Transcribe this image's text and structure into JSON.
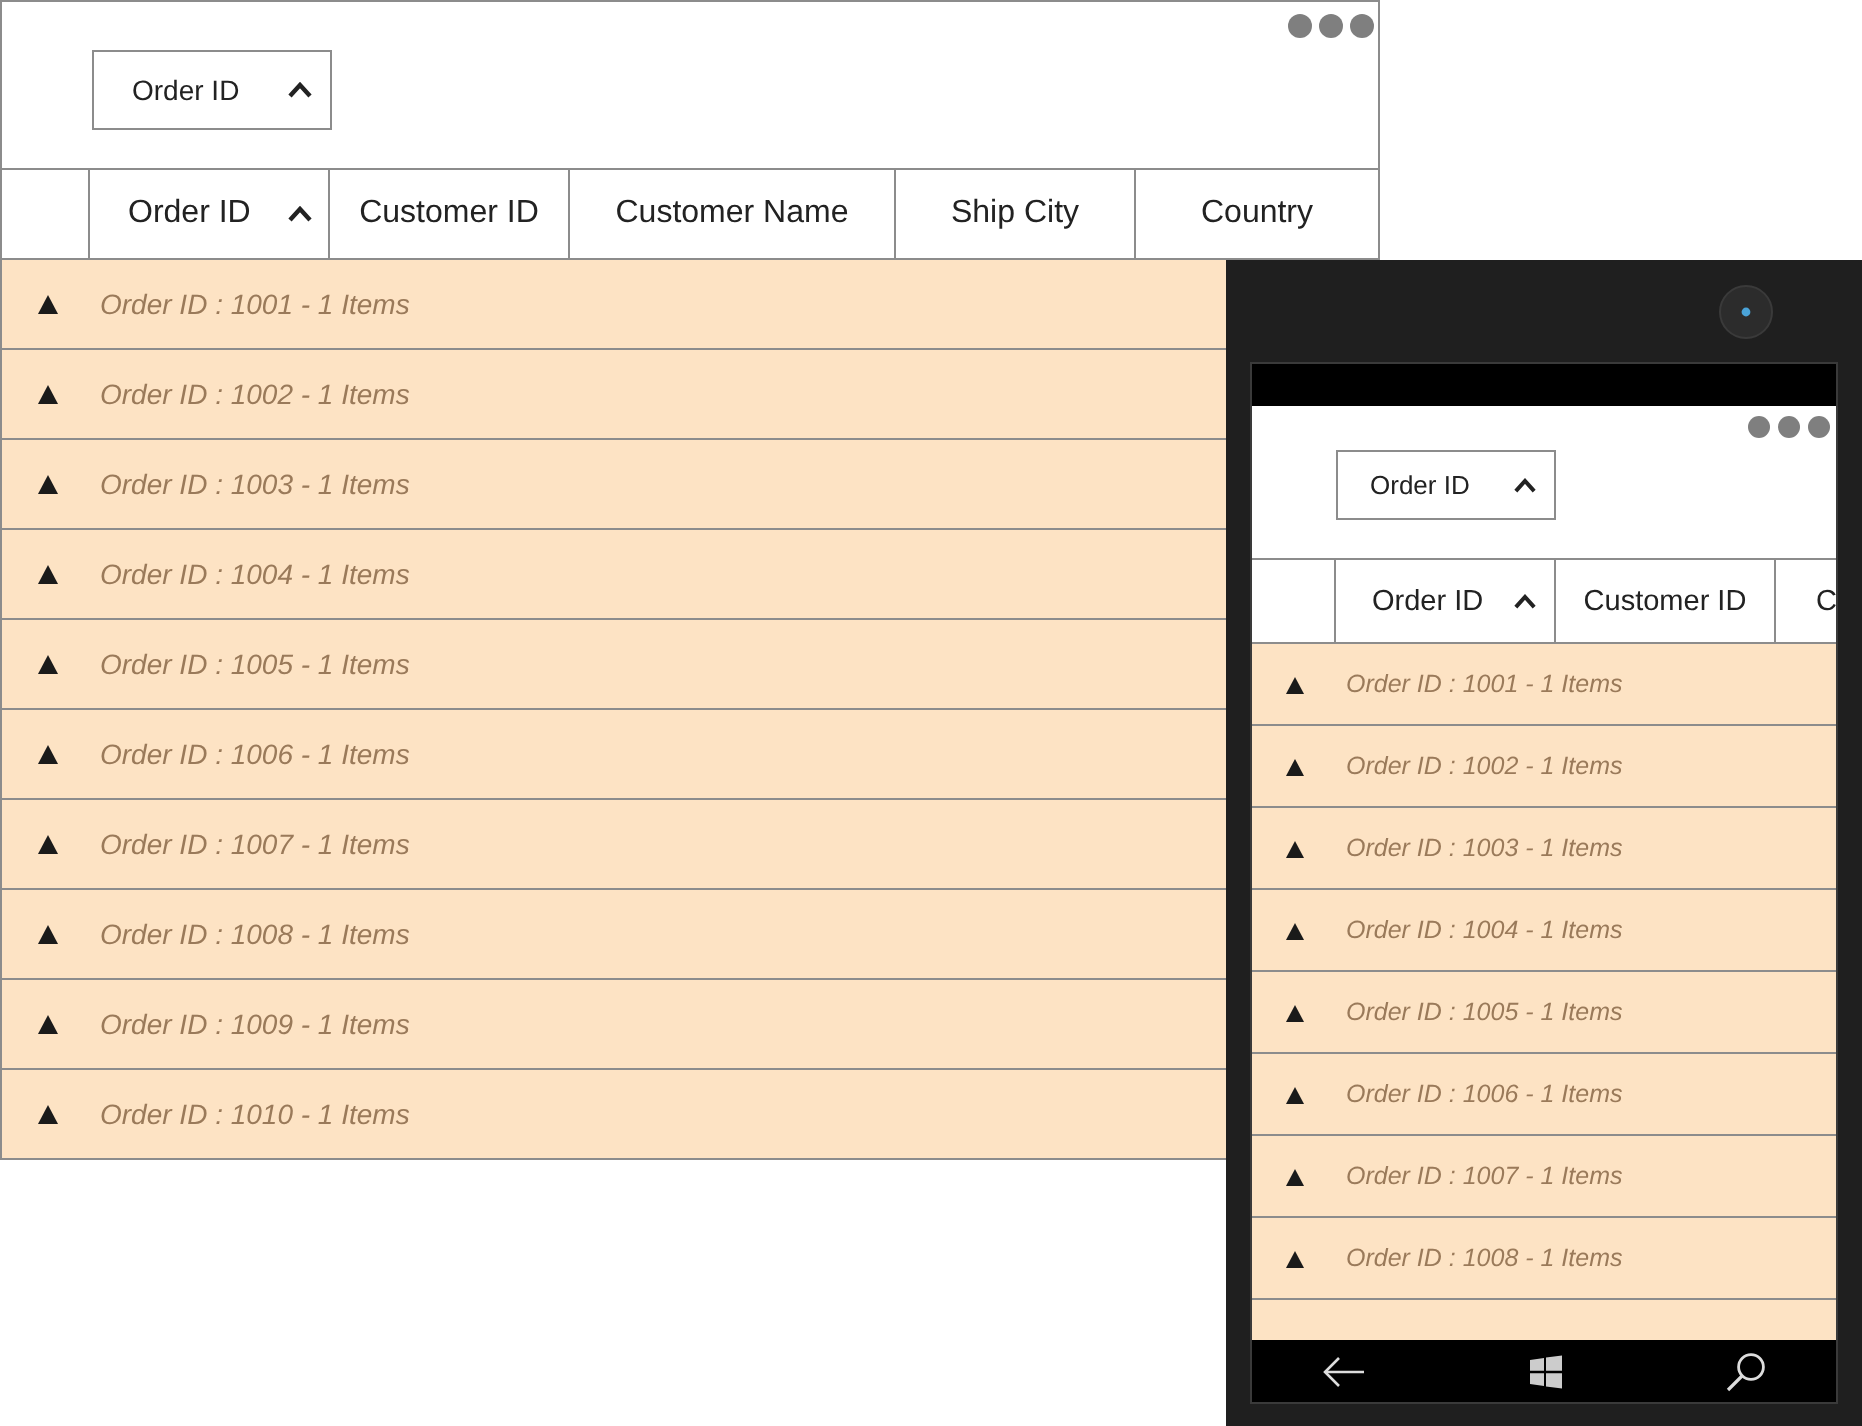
{
  "desktop_grid": {
    "group_drop_area": {
      "chips": [
        {
          "label": "Order ID",
          "sorted": true
        }
      ]
    },
    "columns": [
      {
        "label": "Order ID",
        "sorted": true
      },
      {
        "label": "Customer ID",
        "sorted": false
      },
      {
        "label": "Customer Name",
        "sorted": false
      },
      {
        "label": "Ship City",
        "sorted": false
      },
      {
        "label": "Country",
        "sorted": false
      }
    ],
    "groups": [
      {
        "caption": "Order ID : 1001 - 1 Items",
        "expanded": false
      },
      {
        "caption": "Order ID : 1002 - 1 Items",
        "expanded": false
      },
      {
        "caption": "Order ID : 1003 - 1 Items",
        "expanded": false
      },
      {
        "caption": "Order ID : 1004 - 1 Items",
        "expanded": false
      },
      {
        "caption": "Order ID : 1005 - 1 Items",
        "expanded": false
      },
      {
        "caption": "Order ID : 1006 - 1 Items",
        "expanded": false
      },
      {
        "caption": "Order ID : 1007 - 1 Items",
        "expanded": false
      },
      {
        "caption": "Order ID : 1008 - 1 Items",
        "expanded": false
      },
      {
        "caption": "Order ID : 1009 - 1 Items",
        "expanded": false
      },
      {
        "caption": "Order ID : 1010 - 1 Items",
        "expanded": false
      }
    ]
  },
  "phone": {
    "grid": {
      "group_drop_area": {
        "chips": [
          {
            "label": "Order ID",
            "sorted": true
          }
        ]
      },
      "columns": [
        {
          "label": "Order ID",
          "sorted": true
        },
        {
          "label": "Customer ID",
          "sorted": false
        },
        {
          "label": "C",
          "sorted": false
        }
      ],
      "groups": [
        {
          "caption": "Order ID : 1001 - 1 Items",
          "expanded": false
        },
        {
          "caption": "Order ID : 1002 - 1 Items",
          "expanded": false
        },
        {
          "caption": "Order ID : 1003 - 1 Items",
          "expanded": false
        },
        {
          "caption": "Order ID : 1004 - 1 Items",
          "expanded": false
        },
        {
          "caption": "Order ID : 1005 - 1 Items",
          "expanded": false
        },
        {
          "caption": "Order ID : 1006 - 1 Items",
          "expanded": false
        },
        {
          "caption": "Order ID : 1007 - 1 Items",
          "expanded": false
        },
        {
          "caption": "Order ID : 1008 - 1 Items",
          "expanded": false
        }
      ]
    }
  }
}
